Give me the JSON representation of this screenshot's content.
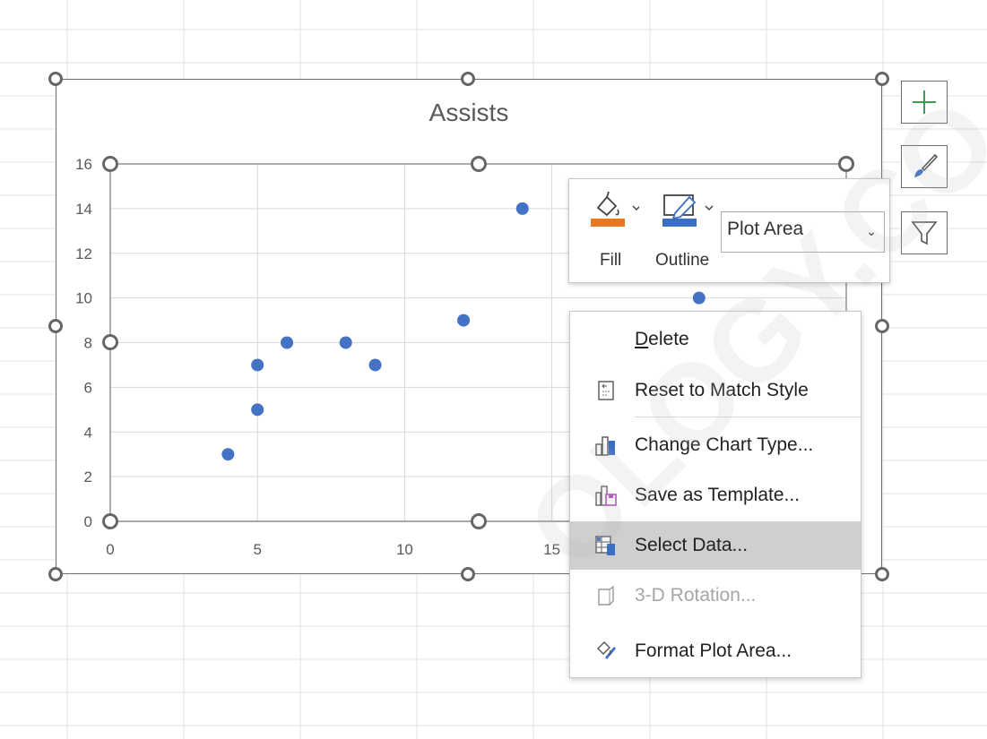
{
  "chart": {
    "title": "Assists"
  },
  "chart_data": {
    "type": "scatter",
    "title": "Assists",
    "xlabel": "",
    "ylabel": "",
    "xlim": [
      0,
      25
    ],
    "ylim": [
      0,
      16
    ],
    "x_ticks": [
      "0",
      "5",
      "10",
      "15"
    ],
    "y_ticks": [
      "0",
      "2",
      "4",
      "6",
      "8",
      "10",
      "12",
      "14",
      "16"
    ],
    "grid": true,
    "legend": "none",
    "series": [
      {
        "color": "#4472c4",
        "points": [
          {
            "x": 4,
            "y": 3
          },
          {
            "x": 5,
            "y": 5
          },
          {
            "x": 5,
            "y": 7
          },
          {
            "x": 6,
            "y": 8
          },
          {
            "x": 8,
            "y": 8
          },
          {
            "x": 9,
            "y": 7
          },
          {
            "x": 12,
            "y": 9
          },
          {
            "x": 14,
            "y": 14
          },
          {
            "x": 20,
            "y": 10
          }
        ]
      }
    ]
  },
  "format_bar": {
    "fill_label": "Fill",
    "outline_label": "Outline",
    "element_select_value": "Plot Area",
    "fill_color": "#e87722",
    "outline_color": "#3a6fc4"
  },
  "context_menu": {
    "items": [
      {
        "label": "Delete",
        "icon": "",
        "enabled": true
      },
      {
        "label": "Reset to Match Style",
        "icon": "reset-style-icon",
        "enabled": true
      },
      {
        "label": "Change Chart Type...",
        "icon": "chart-type-icon",
        "enabled": true
      },
      {
        "label": "Save as Template...",
        "icon": "save-template-icon",
        "enabled": true
      },
      {
        "label": "Select Data...",
        "icon": "select-data-icon",
        "enabled": true,
        "highlighted": true
      },
      {
        "label": "3-D Rotation...",
        "icon": "3d-rotation-icon",
        "enabled": false
      },
      {
        "label": "Format Plot Area...",
        "icon": "format-plot-area-icon",
        "enabled": true
      }
    ]
  },
  "side_buttons": [
    "chart-elements-plus-icon",
    "chart-styles-brush-icon",
    "chart-filters-funnel-icon"
  ],
  "watermark": "OLOGY.CO"
}
